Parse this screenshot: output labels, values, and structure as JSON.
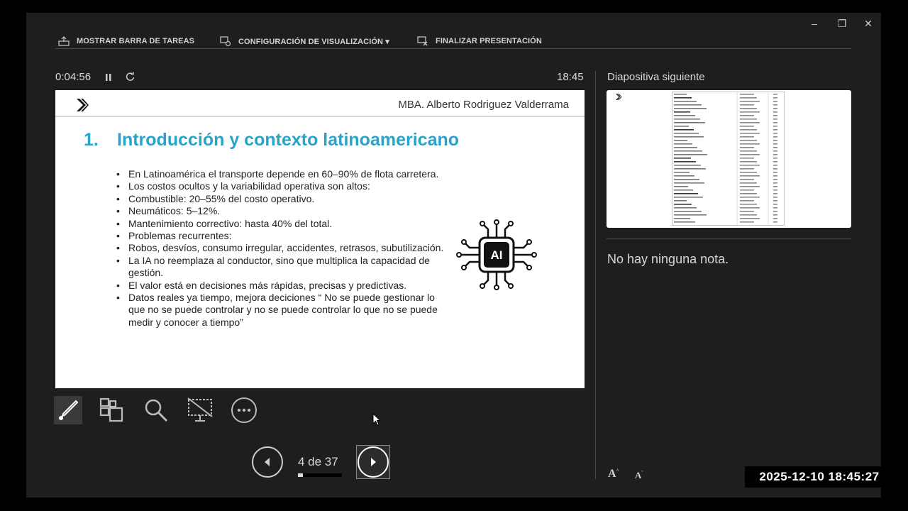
{
  "toolbar": {
    "show_taskbar": "MOSTRAR BARRA DE TAREAS",
    "display_settings": "CONFIGURACIÓN DE VISUALIZACIÓN ▾",
    "end_show": "FINALIZAR PRESENTACIÓN"
  },
  "window_controls": {
    "minimize": "–",
    "restore": "❐",
    "close": "✕"
  },
  "timer": {
    "elapsed": "0:04:56",
    "clock": "18:45"
  },
  "slide": {
    "author": "MBA. Alberto Rodriguez Valderrama",
    "title_number": "1.",
    "title_text": "Introducción y contexto latinoamericano",
    "bullets": [
      "En Latinoamérica el transporte depende en 60–90% de flota carretera.",
      "Los costos ocultos y la variabilidad operativa son altos:",
      "Combustible: 20–55% del costo operativo.",
      "Neumáticos: 5–12%.",
      "Mantenimiento correctivo: hasta 40% del total.",
      "Problemas recurrentes:",
      "Robos, desvíos, consumo irregular, accidentes, retrasos, subutilización.",
      "La IA no reemplaza al conductor, sino que multiplica la capacidad de gestión.",
      "El valor está en decisiones más rápidas, precisas y predictivas.",
      "Datos reales ya tiempo, mejora deciciones  “ No se puede gestionar lo que no se puede controlar y no se puede controlar lo que no se puede medir y conocer a tiempo”"
    ],
    "ai_label": "AI"
  },
  "next_slide": {
    "label": "Diapositiva siguiente"
  },
  "notes": {
    "text": "No hay ninguna nota."
  },
  "navigation": {
    "page": "4 de 37",
    "progress": 0.108
  },
  "font_controls": {
    "increase": "A",
    "decrease": "A"
  },
  "overlay": {
    "timestamp": "2025-12-10 18:45:27"
  },
  "icons": [
    "taskbar-icon",
    "display-settings-icon",
    "end-show-icon",
    "pause-icon",
    "reset-icon",
    "pen-icon",
    "slides-grid-icon",
    "zoom-icon",
    "black-screen-icon",
    "more-options-icon",
    "previous-icon",
    "next-icon",
    "ai-chip-icon",
    "logo-icon"
  ]
}
